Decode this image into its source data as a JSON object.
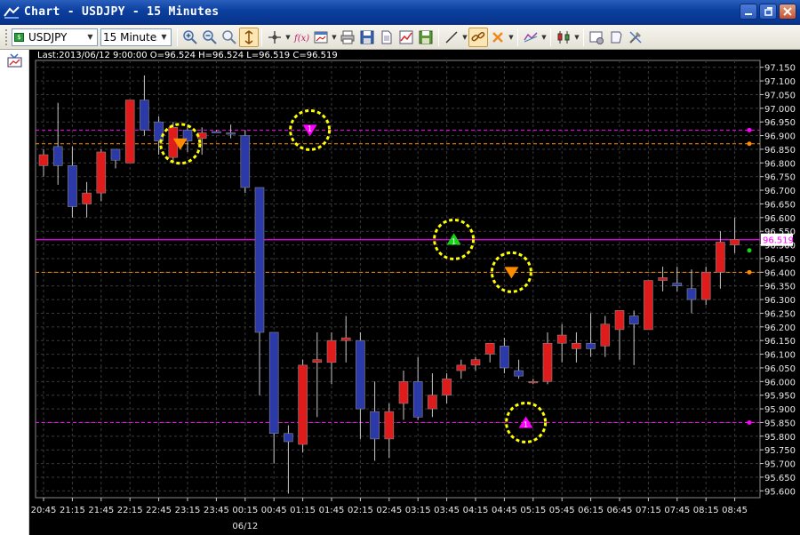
{
  "window": {
    "title": "Chart - USDJPY - 15 Minutes"
  },
  "toolbar": {
    "symbol": "USDJPY",
    "timeframe": "15 Minutes",
    "symbol_badge": "$",
    "tools": [
      "zoom-in-icon",
      "zoom-out-icon",
      "zoom-fit-icon",
      "autoscroll-icon",
      "crosshair-icon",
      "indicator-fx-icon",
      "chart-window-icon",
      "print-icon",
      "save-icon",
      "document-icon",
      "chart-image-icon",
      "export-icon",
      "line-tool-icon",
      "link-icon",
      "delete-icon",
      "object-list-icon",
      "candle-style-icon",
      "properties-icon",
      "template-icon",
      "settings-icon"
    ]
  },
  "chart": {
    "ohlc_text": "Last:2013/06/12 9:00:00 O=96.524 H=96.524 L=96.519 C=96.519",
    "current_price_label": "96.519",
    "date_label": "06/12",
    "colors": {
      "background": "#000000",
      "bull": "#e01b1b",
      "bear": "#2b3aa8",
      "wick": "#c8c8c8",
      "grid": "#3a3a3a",
      "magenta_line": "#ff00ff",
      "orange_line": "#ff8c00",
      "marker_circle": "#ffff00"
    }
  },
  "chart_data": {
    "type": "candlestick",
    "symbol": "USDJPY",
    "timeframe": "15 Minutes",
    "ylim": [
      95.575,
      97.175
    ],
    "y_ticks": [
      "95.600",
      "95.650",
      "95.700",
      "95.750",
      "95.800",
      "95.850",
      "95.900",
      "95.950",
      "96.000",
      "96.050",
      "96.100",
      "96.150",
      "96.200",
      "96.250",
      "96.300",
      "96.350",
      "96.400",
      "96.450",
      "96.500",
      "96.550",
      "96.600",
      "96.650",
      "96.700",
      "96.750",
      "96.800",
      "96.850",
      "96.900",
      "96.950",
      "97.000",
      "97.050",
      "97.100",
      "97.150"
    ],
    "x_tick_labels": [
      "20:45",
      "21:15",
      "21:45",
      "22:15",
      "22:45",
      "23:15",
      "23:45",
      "00:15",
      "00:45",
      "01:15",
      "01:45",
      "02:15",
      "02:45",
      "03:15",
      "03:45",
      "04:15",
      "04:45",
      "05:15",
      "05:45",
      "06:15",
      "06:45",
      "07:15",
      "07:45",
      "08:15",
      "08:45"
    ],
    "candles": [
      {
        "o": 96.79,
        "h": 96.85,
        "l": 96.75,
        "c": 96.83
      },
      {
        "o": 96.86,
        "h": 97.02,
        "l": 96.72,
        "c": 96.79
      },
      {
        "o": 96.79,
        "h": 96.86,
        "l": 96.6,
        "c": 96.64
      },
      {
        "o": 96.65,
        "h": 96.73,
        "l": 96.6,
        "c": 96.69
      },
      {
        "o": 96.69,
        "h": 96.85,
        "l": 96.66,
        "c": 96.84
      },
      {
        "o": 96.85,
        "h": 96.85,
        "l": 96.78,
        "c": 96.81
      },
      {
        "o": 96.8,
        "h": 97.03,
        "l": 96.8,
        "c": 97.03
      },
      {
        "o": 97.03,
        "h": 97.12,
        "l": 96.9,
        "c": 96.92
      },
      {
        "o": 96.95,
        "h": 96.97,
        "l": 96.83,
        "c": 96.88
      },
      {
        "o": 96.82,
        "h": 96.95,
        "l": 96.8,
        "c": 96.93
      },
      {
        "o": 96.92,
        "h": 96.94,
        "l": 96.84,
        "c": 96.88
      },
      {
        "o": 96.89,
        "h": 96.93,
        "l": 96.83,
        "c": 96.91
      },
      {
        "o": 96.915,
        "h": 96.92,
        "l": 96.91,
        "c": 96.91
      },
      {
        "o": 96.91,
        "h": 96.94,
        "l": 96.89,
        "c": 96.905
      },
      {
        "o": 96.9,
        "h": 96.92,
        "l": 96.69,
        "c": 96.71
      },
      {
        "o": 96.71,
        "h": 96.71,
        "l": 95.95,
        "c": 96.18
      },
      {
        "o": 96.18,
        "h": 96.18,
        "l": 95.7,
        "c": 95.81
      },
      {
        "o": 95.81,
        "h": 95.84,
        "l": 95.59,
        "c": 95.78
      },
      {
        "o": 95.77,
        "h": 96.08,
        "l": 95.74,
        "c": 96.06
      },
      {
        "o": 96.07,
        "h": 96.18,
        "l": 95.87,
        "c": 96.08
      },
      {
        "o": 96.07,
        "h": 96.18,
        "l": 95.99,
        "c": 96.15
      },
      {
        "o": 96.15,
        "h": 96.24,
        "l": 96.07,
        "c": 96.16
      },
      {
        "o": 96.15,
        "h": 96.18,
        "l": 95.79,
        "c": 95.9
      },
      {
        "o": 95.89,
        "h": 96.0,
        "l": 95.71,
        "c": 95.79
      },
      {
        "o": 95.79,
        "h": 95.92,
        "l": 95.72,
        "c": 95.89
      },
      {
        "o": 95.92,
        "h": 96.04,
        "l": 95.86,
        "c": 96.0
      },
      {
        "o": 96.0,
        "h": 96.09,
        "l": 95.86,
        "c": 95.87
      },
      {
        "o": 95.9,
        "h": 96.03,
        "l": 95.87,
        "c": 95.95
      },
      {
        "o": 95.95,
        "h": 96.03,
        "l": 95.92,
        "c": 96.01
      },
      {
        "o": 96.04,
        "h": 96.08,
        "l": 96.01,
        "c": 96.06
      },
      {
        "o": 96.06,
        "h": 96.09,
        "l": 96.04,
        "c": 96.08
      },
      {
        "o": 96.1,
        "h": 96.14,
        "l": 96.07,
        "c": 96.14
      },
      {
        "o": 96.13,
        "h": 96.16,
        "l": 96.03,
        "c": 96.05
      },
      {
        "o": 96.04,
        "h": 96.08,
        "l": 96.01,
        "c": 96.02
      },
      {
        "o": 95.995,
        "h": 96.01,
        "l": 95.99,
        "c": 96.0
      },
      {
        "o": 96.0,
        "h": 96.18,
        "l": 95.99,
        "c": 96.14
      },
      {
        "o": 96.14,
        "h": 96.21,
        "l": 96.07,
        "c": 96.17
      },
      {
        "o": 96.12,
        "h": 96.18,
        "l": 96.07,
        "c": 96.14
      },
      {
        "o": 96.14,
        "h": 96.25,
        "l": 96.09,
        "c": 96.12
      },
      {
        "o": 96.13,
        "h": 96.24,
        "l": 96.09,
        "c": 96.21
      },
      {
        "o": 96.19,
        "h": 96.23,
        "l": 96.08,
        "c": 96.26
      },
      {
        "o": 96.24,
        "h": 96.26,
        "l": 96.06,
        "c": 96.21
      },
      {
        "o": 96.19,
        "h": 96.36,
        "l": 96.19,
        "c": 96.37
      },
      {
        "o": 96.37,
        "h": 96.42,
        "l": 96.33,
        "c": 96.38
      },
      {
        "o": 96.36,
        "h": 96.42,
        "l": 96.33,
        "c": 96.35
      },
      {
        "o": 96.34,
        "h": 96.41,
        "l": 96.25,
        "c": 96.3
      },
      {
        "o": 96.3,
        "h": 96.42,
        "l": 96.28,
        "c": 96.4
      },
      {
        "o": 96.4,
        "h": 96.55,
        "l": 96.34,
        "c": 96.51
      },
      {
        "o": 96.5,
        "h": 96.6,
        "l": 96.47,
        "c": 96.52
      }
    ],
    "horizontal_lines": [
      {
        "price": 96.92,
        "color": "magenta",
        "style": "dashed"
      },
      {
        "price": 96.87,
        "color": "orange",
        "style": "dashed"
      },
      {
        "price": 96.519,
        "color": "magenta",
        "style": "solid"
      },
      {
        "price": 96.4,
        "color": "orange",
        "style": "dashed"
      },
      {
        "price": 95.85,
        "color": "magenta",
        "style": "dashed"
      }
    ],
    "markers": [
      {
        "label": "",
        "shape": "down-triangle",
        "color": "orange",
        "price": 96.87,
        "candle": 9
      },
      {
        "label": "1",
        "shape": "down-triangle",
        "color": "magenta",
        "price": 96.92,
        "candle": 18
      },
      {
        "label": "1",
        "shape": "up-triangle",
        "color": "green",
        "price": 96.52,
        "candle": 28
      },
      {
        "label": "",
        "shape": "down-triangle",
        "color": "orange",
        "price": 96.4,
        "candle": 32
      },
      {
        "label": "1",
        "shape": "up-triangle",
        "color": "magenta",
        "price": 95.85,
        "candle": 33
      }
    ]
  }
}
